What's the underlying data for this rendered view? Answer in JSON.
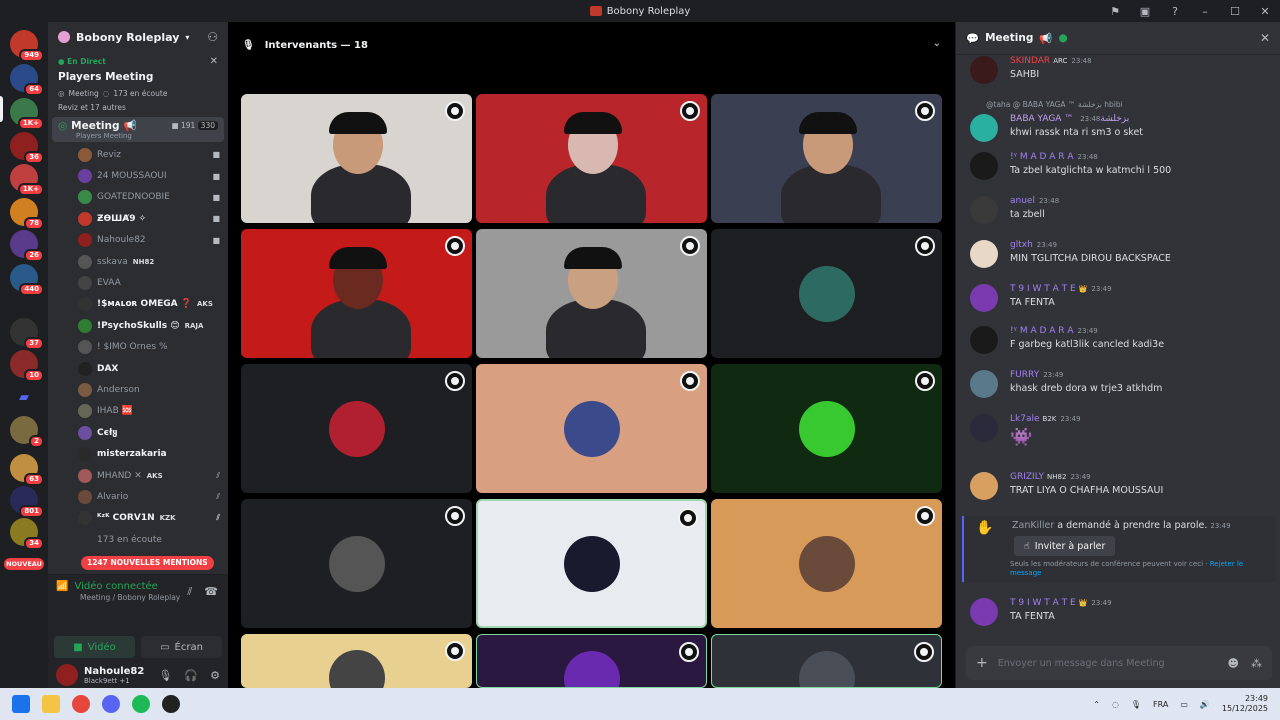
{
  "window": {
    "title": "Bobony Roleplay"
  },
  "rail": {
    "badges": [
      "949",
      "64",
      "1K+",
      "36",
      "1K+",
      "78",
      "26",
      "440",
      "37",
      "10",
      "2",
      "63",
      "801",
      "34"
    ],
    "new_label": "NOUVEAU"
  },
  "sidebar": {
    "server_name": "Bobony Roleplay",
    "live_label": "En Direct",
    "live_title": "Players Meeting",
    "live_meta": "Meeting",
    "live_listeners": "173 en écoute",
    "live_others": "Reviz et 17 autres",
    "stage_channel": {
      "name": "Meeting",
      "count_video": "191",
      "count_users": "330",
      "topic": "Players Meeting"
    },
    "members": [
      {
        "name": "Reviz",
        "tag": "",
        "color": "#8a5a3a"
      },
      {
        "name": "24 MOUSSAOUI",
        "tag": "",
        "color": "#6b3fa0"
      },
      {
        "name": "GOATEDNOOBIE",
        "tag": "",
        "color": "#3a8a4a"
      },
      {
        "name": "ƵƟШȺ9 ✧",
        "tag": "",
        "color": "#c0392b"
      },
      {
        "name": "Nahoule82",
        "tag": "",
        "color": "#8e2020"
      },
      {
        "name": "sskava",
        "tag": "NH82",
        "color": "#555"
      },
      {
        "name": "EVAA",
        "tag": "",
        "color": "#444"
      },
      {
        "name": "!$ᴍᴀʟᴏʀ OMEGA ❓",
        "tag": "AKS",
        "color": "#333"
      },
      {
        "name": "!PsychoSkulls 😊",
        "tag": "RAJA",
        "color": "#2e7d32"
      },
      {
        "name": "! $IMO Ornes %",
        "tag": "",
        "color": "#555"
      },
      {
        "name": "DAX",
        "tag": "",
        "color": "#222"
      },
      {
        "name": "Anderson",
        "tag": "",
        "color": "#7a5a40"
      },
      {
        "name": "IHAB 🆘",
        "tag": "",
        "color": "#665"
      },
      {
        "name": "Cєłყ",
        "tag": "",
        "color": "#6b4fa0"
      },
      {
        "name": "misterzakaria",
        "tag": "",
        "color": "#2a2a2a"
      },
      {
        "name": "MHAND ✕",
        "tag": "AKS",
        "color": "#a05a5a"
      },
      {
        "name": "Alvario",
        "tag": "",
        "color": "#6a4a3a"
      },
      {
        "name": "ᴷᶻᴷ CORV1N",
        "tag": "KZK",
        "color": "#333"
      },
      {
        "name": "173 en écoute",
        "tag": "",
        "color": "#2b2d31"
      }
    ],
    "mentions_label": "1247 NOUVELLES MENTIONS",
    "voice": {
      "status": "Vidéo connectée",
      "sub": "Meeting / Bobony Roleplay"
    },
    "video_tab": "Vidéo",
    "screen_tab": "Écran",
    "user": {
      "name": "Nahoule82",
      "status": "Black9ett +1"
    }
  },
  "main": {
    "speakers_label": "Intervenants — 18",
    "tiles": [
      {
        "bg": "#d8d4cf",
        "kind": "person",
        "skin": "#c99a7a"
      },
      {
        "bg": "#b8262b",
        "kind": "person",
        "skin": "#d8b8b0"
      },
      {
        "bg": "#3a3f52",
        "kind": "person",
        "skin": "#c99a7a"
      },
      {
        "bg": "#c41a1a",
        "kind": "person",
        "skin": "#6b2a20"
      },
      {
        "bg": "#9a9a9a",
        "kind": "person",
        "skin": "#c9a080"
      },
      {
        "bg": "#1e1f22",
        "kind": "avatar",
        "color": "#2d6b62"
      },
      {
        "bg": "#1e1f22",
        "kind": "avatar",
        "color": "#b02030"
      },
      {
        "bg": "#d8a080",
        "kind": "avatar",
        "color": "#3a4a8a"
      },
      {
        "bg": "#0f2a10",
        "kind": "avatar",
        "color": "#38c830"
      },
      {
        "bg": "#1e1f22",
        "kind": "avatar",
        "color": "#555"
      },
      {
        "bg": "#e8ecf0",
        "kind": "avatar",
        "color": "#1a1a2e"
      },
      {
        "bg": "#d79a58",
        "kind": "avatar",
        "color": "#6a4a3a"
      },
      {
        "bg": "#e8d090",
        "kind": "avatar",
        "color": "#444"
      },
      {
        "bg": "#2a1840",
        "kind": "avatar",
        "color": "#6a2ab0"
      },
      {
        "bg": "#2e3238",
        "kind": "avatar",
        "color": "#4a4e56"
      }
    ]
  },
  "chat": {
    "title": "Meeting",
    "reply_line": "@taha  @ BABA YAGA ™ بزخلشة hbibi",
    "messages": [
      {
        "author": "SKINDAR",
        "badge": "ARC",
        "time": "23:48",
        "text": "SAHBI",
        "color": "#f23f43",
        "av": "#3a1a1a"
      },
      {
        "author": "BABA YAGA ™ بزخلشة",
        "badge": "",
        "time": "23:48",
        "text": "khwi rassk nta ri sm3 o sket",
        "color": "#c0a0f0",
        "av": "#2ab0a0"
      },
      {
        "author": "!ᵞ M A D A R A",
        "badge": "",
        "time": "23:48",
        "text": "Ta zbel katglichta w katmchi l 500",
        "color": "#a080f0",
        "av": "#1a1a1a"
      },
      {
        "author": "anuel",
        "badge": "",
        "time": "23:48",
        "text": "ta zbell",
        "color": "#a080f0",
        "av": "#3a3a3a"
      },
      {
        "author": "gltxh",
        "badge": "",
        "time": "23:49",
        "text": "MIN TGLITCHA DIROU BACKSPACE",
        "color": "#a080f0",
        "av": "#e8d8c8"
      },
      {
        "author": "T 9 I W T A T E",
        "badge": "👑",
        "time": "23:49",
        "text": "TA FENTA",
        "color": "#a080f0",
        "av": "#7a3ab0"
      },
      {
        "author": "!ᵞ M A D A R A",
        "badge": "",
        "time": "23:49",
        "text": "F garbeg katl3lik cancled kadi3e",
        "color": "#a080f0",
        "av": "#1a1a1a"
      },
      {
        "author": "FURRY",
        "badge": "",
        "time": "23:49",
        "text": "khask dreb dora w trje3 atkhdm",
        "color": "#a080f0",
        "av": "#5a7a8a"
      },
      {
        "author": "Lk7ale",
        "badge": "B2K",
        "time": "23:49",
        "text": "👾",
        "color": "#a080f0",
        "av": "#2a2a3a"
      },
      {
        "author": "GRIZILY",
        "badge": "NH82",
        "time": "23:49",
        "text": "TRAT LIYA O CHAFHA MOUSSAUI",
        "color": "#a080f0",
        "av": "#d8a060"
      },
      {
        "author": "T 9 I W T A T E",
        "badge": "👑",
        "time": "23:49",
        "text": "TA FENTA",
        "color": "#a080f0",
        "av": "#7a3ab0"
      }
    ],
    "raise": {
      "who": "ZanKiller",
      "text": " a demandé à prendre la parole.",
      "time": "23:49",
      "button": "Inviter à parler",
      "note": "Seuls les modérateurs de conférence peuvent voir ceci · ",
      "link": "Rejeter le message"
    },
    "composer_placeholder": "Envoyer un message dans Meeting"
  },
  "taskbar": {
    "lang": "FRA",
    "time": "23:49",
    "date": "15/12/2025"
  }
}
